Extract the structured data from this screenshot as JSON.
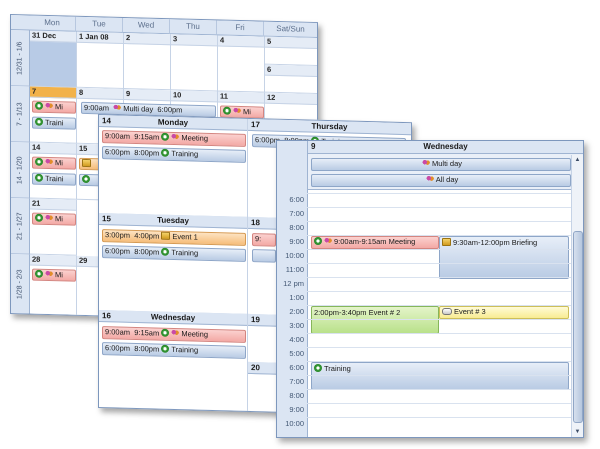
{
  "month": {
    "days": [
      "Mon",
      "Tue",
      "Wed",
      "Thu",
      "Fri",
      "Sat/Sun"
    ],
    "weeks": [
      "12/31 - 1/6",
      "7 - 1/13",
      "14 - 1/20",
      "21 - 1/27",
      "1/28 - 2/3"
    ],
    "dates": {
      "w1": [
        "31 Dec",
        "1 Jan 08",
        "2",
        "3",
        "4",
        "5",
        "6"
      ],
      "w2": [
        "7",
        "8",
        "9",
        "10",
        "11",
        "12"
      ],
      "w3": [
        "14",
        "15"
      ],
      "w4": [
        "21"
      ],
      "w5": [
        "28",
        "29"
      ]
    },
    "events": {
      "mon_meeting": "Mi",
      "mon_training": "Traini",
      "tue_lock": "",
      "multi_time_start": "9:00am",
      "multi_label": "Multi day",
      "multi_time_end": "6:00pm",
      "fri_meeting": "Mi",
      "w3_mon_meeting": "Mi",
      "w3_mon_training": "Traini",
      "w4_mon_meeting": "Mi",
      "w5_mon_meeting": "Mi"
    }
  },
  "week": {
    "days": [
      {
        "num": "14",
        "label": "Monday"
      },
      {
        "num": "17",
        "label": "Thursday"
      },
      {
        "num": "15",
        "label": "Tuesday"
      },
      {
        "num": "18",
        "label": ""
      },
      {
        "num": "16",
        "label": "Wednesday"
      },
      {
        "num": "19",
        "label": ""
      },
      {
        "num": "20",
        "label": ""
      }
    ],
    "mon_meeting": {
      "start": "9:00am",
      "end": "9:15am",
      "title": "Meeting"
    },
    "mon_training": {
      "start": "6:00pm",
      "end": "8:00pm",
      "title": "Training"
    },
    "thu_training": {
      "start": "6:00pm",
      "end": "8:00pm",
      "title": "Training"
    },
    "tue_event": {
      "start": "3:00pm",
      "end": "4:00pm",
      "title": "Event 1"
    },
    "tue_training": {
      "start": "6:00pm",
      "end": "8:00pm",
      "title": "Training"
    },
    "wed_meeting": {
      "start": "9:00am",
      "end": "9:15am",
      "title": "Meeting"
    },
    "wed_training": {
      "start": "6:00pm",
      "end": "8:00pm",
      "title": "Training"
    },
    "col_partial": "9:"
  },
  "day": {
    "num": "9",
    "label": "Wednesday",
    "all_day": [
      "Multi day",
      "All day"
    ],
    "times": [
      "6:00",
      "7:00",
      "8:00",
      "9:00",
      "10:00",
      "11:00",
      "12 pm",
      "1:00",
      "2:00",
      "3:00",
      "4:00",
      "5:00",
      "6:00",
      "7:00",
      "8:00",
      "9:00",
      "10:00"
    ],
    "events": {
      "meeting": "9:00am-9:15am Meeting",
      "briefing": "9:30am-12:00pm Briefing",
      "event2": "2:00pm-3:40pm Event # 2",
      "event3": "Event # 3",
      "training": "Training"
    }
  },
  "colors": {
    "header_bg": "#dbe5f3",
    "today": "#f2b24a",
    "meeting": "#f3a9a5",
    "event": "#f6bd7a",
    "event2": "#b9e18a",
    "event3": "#f8ec92"
  }
}
